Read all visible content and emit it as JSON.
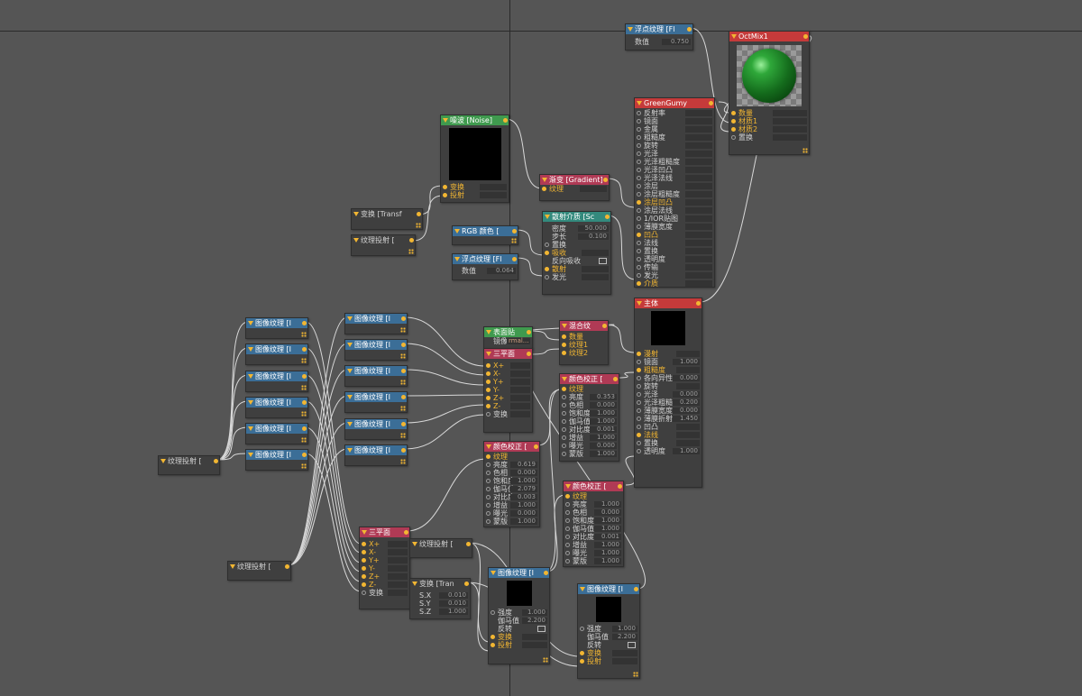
{
  "colors": {
    "background": "#555555",
    "port": "#f2b632",
    "header_texture": "#3b6e97",
    "header_material": "#c53a3a",
    "header_color_correct": "#b03a55",
    "header_green": "#3f9a4e",
    "header_teal": "#338a7d"
  },
  "nodes": {
    "float_top": {
      "title": "浮点纹理 [Fl",
      "rows": [
        {
          "label": "数值",
          "value": "0.750"
        }
      ]
    },
    "octmix": {
      "title": "OctMix1",
      "rows": [
        {
          "label": "数量"
        },
        {
          "label": "材质1"
        },
        {
          "label": "材质2"
        },
        {
          "label": "置换"
        }
      ]
    },
    "greengumy": {
      "title": "GreenGumy",
      "rows": [
        {
          "label": "反射率"
        },
        {
          "label": "镜面"
        },
        {
          "label": "金属"
        },
        {
          "label": "粗糙度"
        },
        {
          "label": "旋转"
        },
        {
          "label": "光泽"
        },
        {
          "label": "光泽粗糙度"
        },
        {
          "label": "光泽凹凸"
        },
        {
          "label": "光泽法线"
        },
        {
          "label": "涂层"
        },
        {
          "label": "涂层粗糙度"
        },
        {
          "label": "涂层凹凸"
        },
        {
          "label": "涂层法线"
        },
        {
          "label": "1/IOR贴图"
        },
        {
          "label": "薄膜宽度"
        },
        {
          "label": "凹凸"
        },
        {
          "label": "法线"
        },
        {
          "label": "置换"
        },
        {
          "label": "透明度"
        },
        {
          "label": "传输"
        },
        {
          "label": "发光"
        },
        {
          "label": "介质"
        }
      ]
    },
    "noise": {
      "title": "噪波 [Noise]",
      "rows": [
        {
          "label": "变换"
        },
        {
          "label": "投射"
        }
      ]
    },
    "gradient": {
      "title": "渐变 [Gradient]",
      "rows": [
        {
          "label": "纹理"
        }
      ]
    },
    "transform_a": {
      "title": "变换 [Transf"
    },
    "proj_a": {
      "title": "纹理投射 ["
    },
    "rgb": {
      "title": "RGB 颜色 ["
    },
    "float_mid": {
      "title": "浮点纹理 [Fl",
      "rows": [
        {
          "label": "数值",
          "value": "0.064"
        }
      ]
    },
    "scatter": {
      "title": "散射介质 [Sc",
      "rows": [
        {
          "label": "密度",
          "value": "50.000"
        },
        {
          "label": "步长",
          "value": "0.100"
        },
        {
          "label": "置换"
        },
        {
          "label": "吸收"
        },
        {
          "label": "反向吸收"
        },
        {
          "label": "散射"
        },
        {
          "label": "发光"
        }
      ]
    },
    "main": {
      "title": "主体",
      "rows": [
        {
          "label": "漫射"
        },
        {
          "label": "镜面",
          "value": "1.000"
        },
        {
          "label": "粗糙度"
        },
        {
          "label": "各向异性",
          "value": "0.000"
        },
        {
          "label": "旋转"
        },
        {
          "label": "光泽",
          "value": "0.000"
        },
        {
          "label": "光泽粗糙",
          "value": "0.200"
        },
        {
          "label": "薄膜宽度",
          "value": "0.000"
        },
        {
          "label": "薄膜折射",
          "value": "1.450"
        },
        {
          "label": "凹凸"
        },
        {
          "label": "法线"
        },
        {
          "label": "置换"
        },
        {
          "label": "透明度",
          "value": "1.000"
        }
      ]
    },
    "blend": {
      "title": "混合纹",
      "rows": [
        {
          "label": "数量"
        },
        {
          "label": "纹理1"
        },
        {
          "label": "纹理2"
        }
      ]
    },
    "decal": {
      "title": "表面贴",
      "sub": "镜像",
      "subval": "rmal..."
    },
    "triplanar_top": {
      "title": "三平面",
      "rows": [
        {
          "label": "X+"
        },
        {
          "label": "X-"
        },
        {
          "label": "Y+"
        },
        {
          "label": "Y-"
        },
        {
          "label": "Z+"
        },
        {
          "label": "Z-"
        },
        {
          "label": "变换"
        }
      ]
    },
    "cc1": {
      "title": "颜色校正 [",
      "rows": [
        {
          "label": "纹理"
        },
        {
          "label": "亮度",
          "value": "0.353"
        },
        {
          "label": "色相",
          "value": "0.000"
        },
        {
          "label": "饱和度",
          "value": "1.000"
        },
        {
          "label": "伽马值",
          "value": "1.000"
        },
        {
          "label": "对比度",
          "value": "0.001"
        },
        {
          "label": "增益",
          "value": "1.000"
        },
        {
          "label": "曝光",
          "value": "0.000"
        },
        {
          "label": "蒙版",
          "value": "1.000"
        }
      ]
    },
    "cc2": {
      "title": "颜色校正 [",
      "rows": [
        {
          "label": "纹理"
        },
        {
          "label": "亮度",
          "value": "0.619"
        },
        {
          "label": "色相",
          "value": "0.000"
        },
        {
          "label": "饱和度",
          "value": "1.000"
        },
        {
          "label": "伽马值",
          "value": "2.079"
        },
        {
          "label": "对比度",
          "value": "0.003"
        },
        {
          "label": "增益",
          "value": "1.000"
        },
        {
          "label": "曝光",
          "value": "0.000"
        },
        {
          "label": "蒙版",
          "value": "1.000"
        }
      ]
    },
    "cc3": {
      "title": "颜色校正 [",
      "rows": [
        {
          "label": "纹理"
        },
        {
          "label": "亮度",
          "value": "1.000"
        },
        {
          "label": "色相",
          "value": "0.000"
        },
        {
          "label": "饱和度",
          "value": "1.000"
        },
        {
          "label": "伽马值",
          "value": "1.000"
        },
        {
          "label": "对比度",
          "value": "0.001"
        },
        {
          "label": "增益",
          "value": "1.000"
        },
        {
          "label": "曝光",
          "value": "1.000"
        },
        {
          "label": "蒙版",
          "value": "1.000"
        }
      ]
    },
    "img_left": {
      "title": "图像纹理 [I"
    },
    "img_mid": {
      "title": "图像纹理 [I"
    },
    "proj_left": {
      "title": "纹理投射 ["
    },
    "proj_bottom": {
      "title": "纹理投射 ["
    },
    "triplanar_bottom": {
      "title": "三平面",
      "rows": [
        {
          "label": "X+"
        },
        {
          "label": "X-"
        },
        {
          "label": "Y+"
        },
        {
          "label": "Y-"
        },
        {
          "label": "Z+"
        },
        {
          "label": "Z-"
        },
        {
          "label": "变换"
        }
      ]
    },
    "proj_c": {
      "title": "纹理投射 ["
    },
    "transform_b": {
      "title": "变换 [Tran",
      "rows": [
        {
          "label": "S.X",
          "value": "0.010"
        },
        {
          "label": "S.Y",
          "value": "0.010"
        },
        {
          "label": "S.Z",
          "value": "1.000"
        }
      ]
    },
    "img_b1": {
      "title": "图像纹理 [I",
      "rows": [
        {
          "label": "强度",
          "value": "1.000"
        },
        {
          "label": "伽马值",
          "value": "2.200"
        },
        {
          "label": "反转"
        },
        {
          "label": "变换"
        },
        {
          "label": "投射"
        }
      ]
    },
    "img_b2": {
      "title": "图像纹理 [I",
      "rows": [
        {
          "label": "强度",
          "value": "1.000"
        },
        {
          "label": "伽马值",
          "value": "2.200"
        },
        {
          "label": "反转"
        },
        {
          "label": "变换"
        },
        {
          "label": "投射"
        }
      ]
    }
  }
}
